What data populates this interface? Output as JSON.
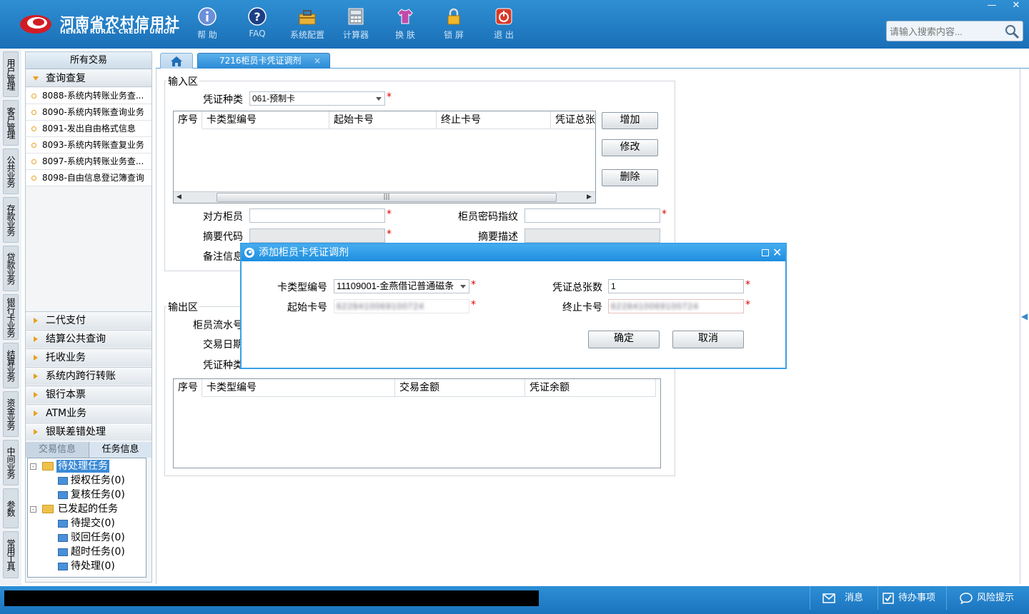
{
  "app": {
    "logo_cn": "河南省农村信用社",
    "logo_en": "HENAN RURAL CREDIT UNION"
  },
  "toolbar": [
    {
      "label": "帮 助",
      "icon": "info-icon"
    },
    {
      "label": "FAQ",
      "icon": "question-icon"
    },
    {
      "label": "系统配置",
      "icon": "toolbox-icon"
    },
    {
      "label": "计算器",
      "icon": "calculator-icon"
    },
    {
      "label": "换 肤",
      "icon": "shirt-icon"
    },
    {
      "label": "锁 屏",
      "icon": "lock-icon"
    },
    {
      "label": "退 出",
      "icon": "power-icon"
    }
  ],
  "search": {
    "placeholder": "请输入搜索内容..."
  },
  "vtabs": [
    "用户管理",
    "客户管理",
    "公共业务",
    "存款业务",
    "贷款业务",
    "银行卡业务",
    "结算业务",
    "资金业务",
    "中间业务",
    "参数",
    "常用工具"
  ],
  "leftpanel": {
    "all_tx": "所有交易",
    "query_section": "查询查复",
    "query_items": [
      "8088-系统内转账业务查...",
      "8090-系统内转账查询业务",
      "8091-发出自由格式信息",
      "8093-系统内转账查复业务",
      "8097-系统内转账业务查...",
      "8098-自由信息登记簿查询"
    ],
    "menus": [
      "二代支付",
      "结算公共查询",
      "托收业务",
      "系统内跨行转账",
      "银行本票",
      "ATM业务",
      "银联差错处理"
    ],
    "tabs": {
      "tx_info": "交易信息",
      "task_info": "任务信息"
    },
    "tree": {
      "pending": "待处理任务",
      "auth": "授权任务(0)",
      "review": "复核任务(0)",
      "initiated": "已发起的任务",
      "to_submit": "待提交(0)",
      "rejected": "驳回任务(0)",
      "timeout": "超时任务(0)",
      "to_process": "待处理(0)"
    }
  },
  "tabs": {
    "active": "7216柜员卡凭证调剂"
  },
  "input_area": {
    "legend": "输入区",
    "voucher_type_label": "凭证种类",
    "voucher_type_value": "061-预制卡",
    "grid_headers": [
      "序号",
      "卡类型编号",
      "起始卡号",
      "终止卡号",
      "凭证总张"
    ],
    "add_btn": "增加",
    "edit_btn": "修改",
    "delete_btn": "删除",
    "counterpart_label": "对方柜员",
    "fingerprint_label": "柜员密码指纹",
    "summary_code_label": "摘要代码",
    "summary_desc_label": "摘要描述",
    "remark_label": "备注信息"
  },
  "output_area": {
    "legend": "输出区",
    "serial_label": "柜员流水号",
    "date_label": "交易日期",
    "voucher_type_label": "凭证种类",
    "grid_headers": [
      "序号",
      "卡类型编号",
      "交易金额",
      "凭证余额"
    ]
  },
  "dialog": {
    "title": "添加柜员卡凭证调剂",
    "card_type_label": "卡类型编号",
    "card_type_value": "11109001-金燕借记普通磁条",
    "count_label": "凭证总张数",
    "count_value": "1",
    "start_label": "起始卡号",
    "start_value": "6228410069100724",
    "end_label": "终止卡号",
    "end_value": "6228410069100724",
    "ok_btn": "确定",
    "cancel_btn": "取消"
  },
  "statusbar": {
    "message": "消息",
    "todo": "待办事项",
    "risk": "风险提示"
  }
}
